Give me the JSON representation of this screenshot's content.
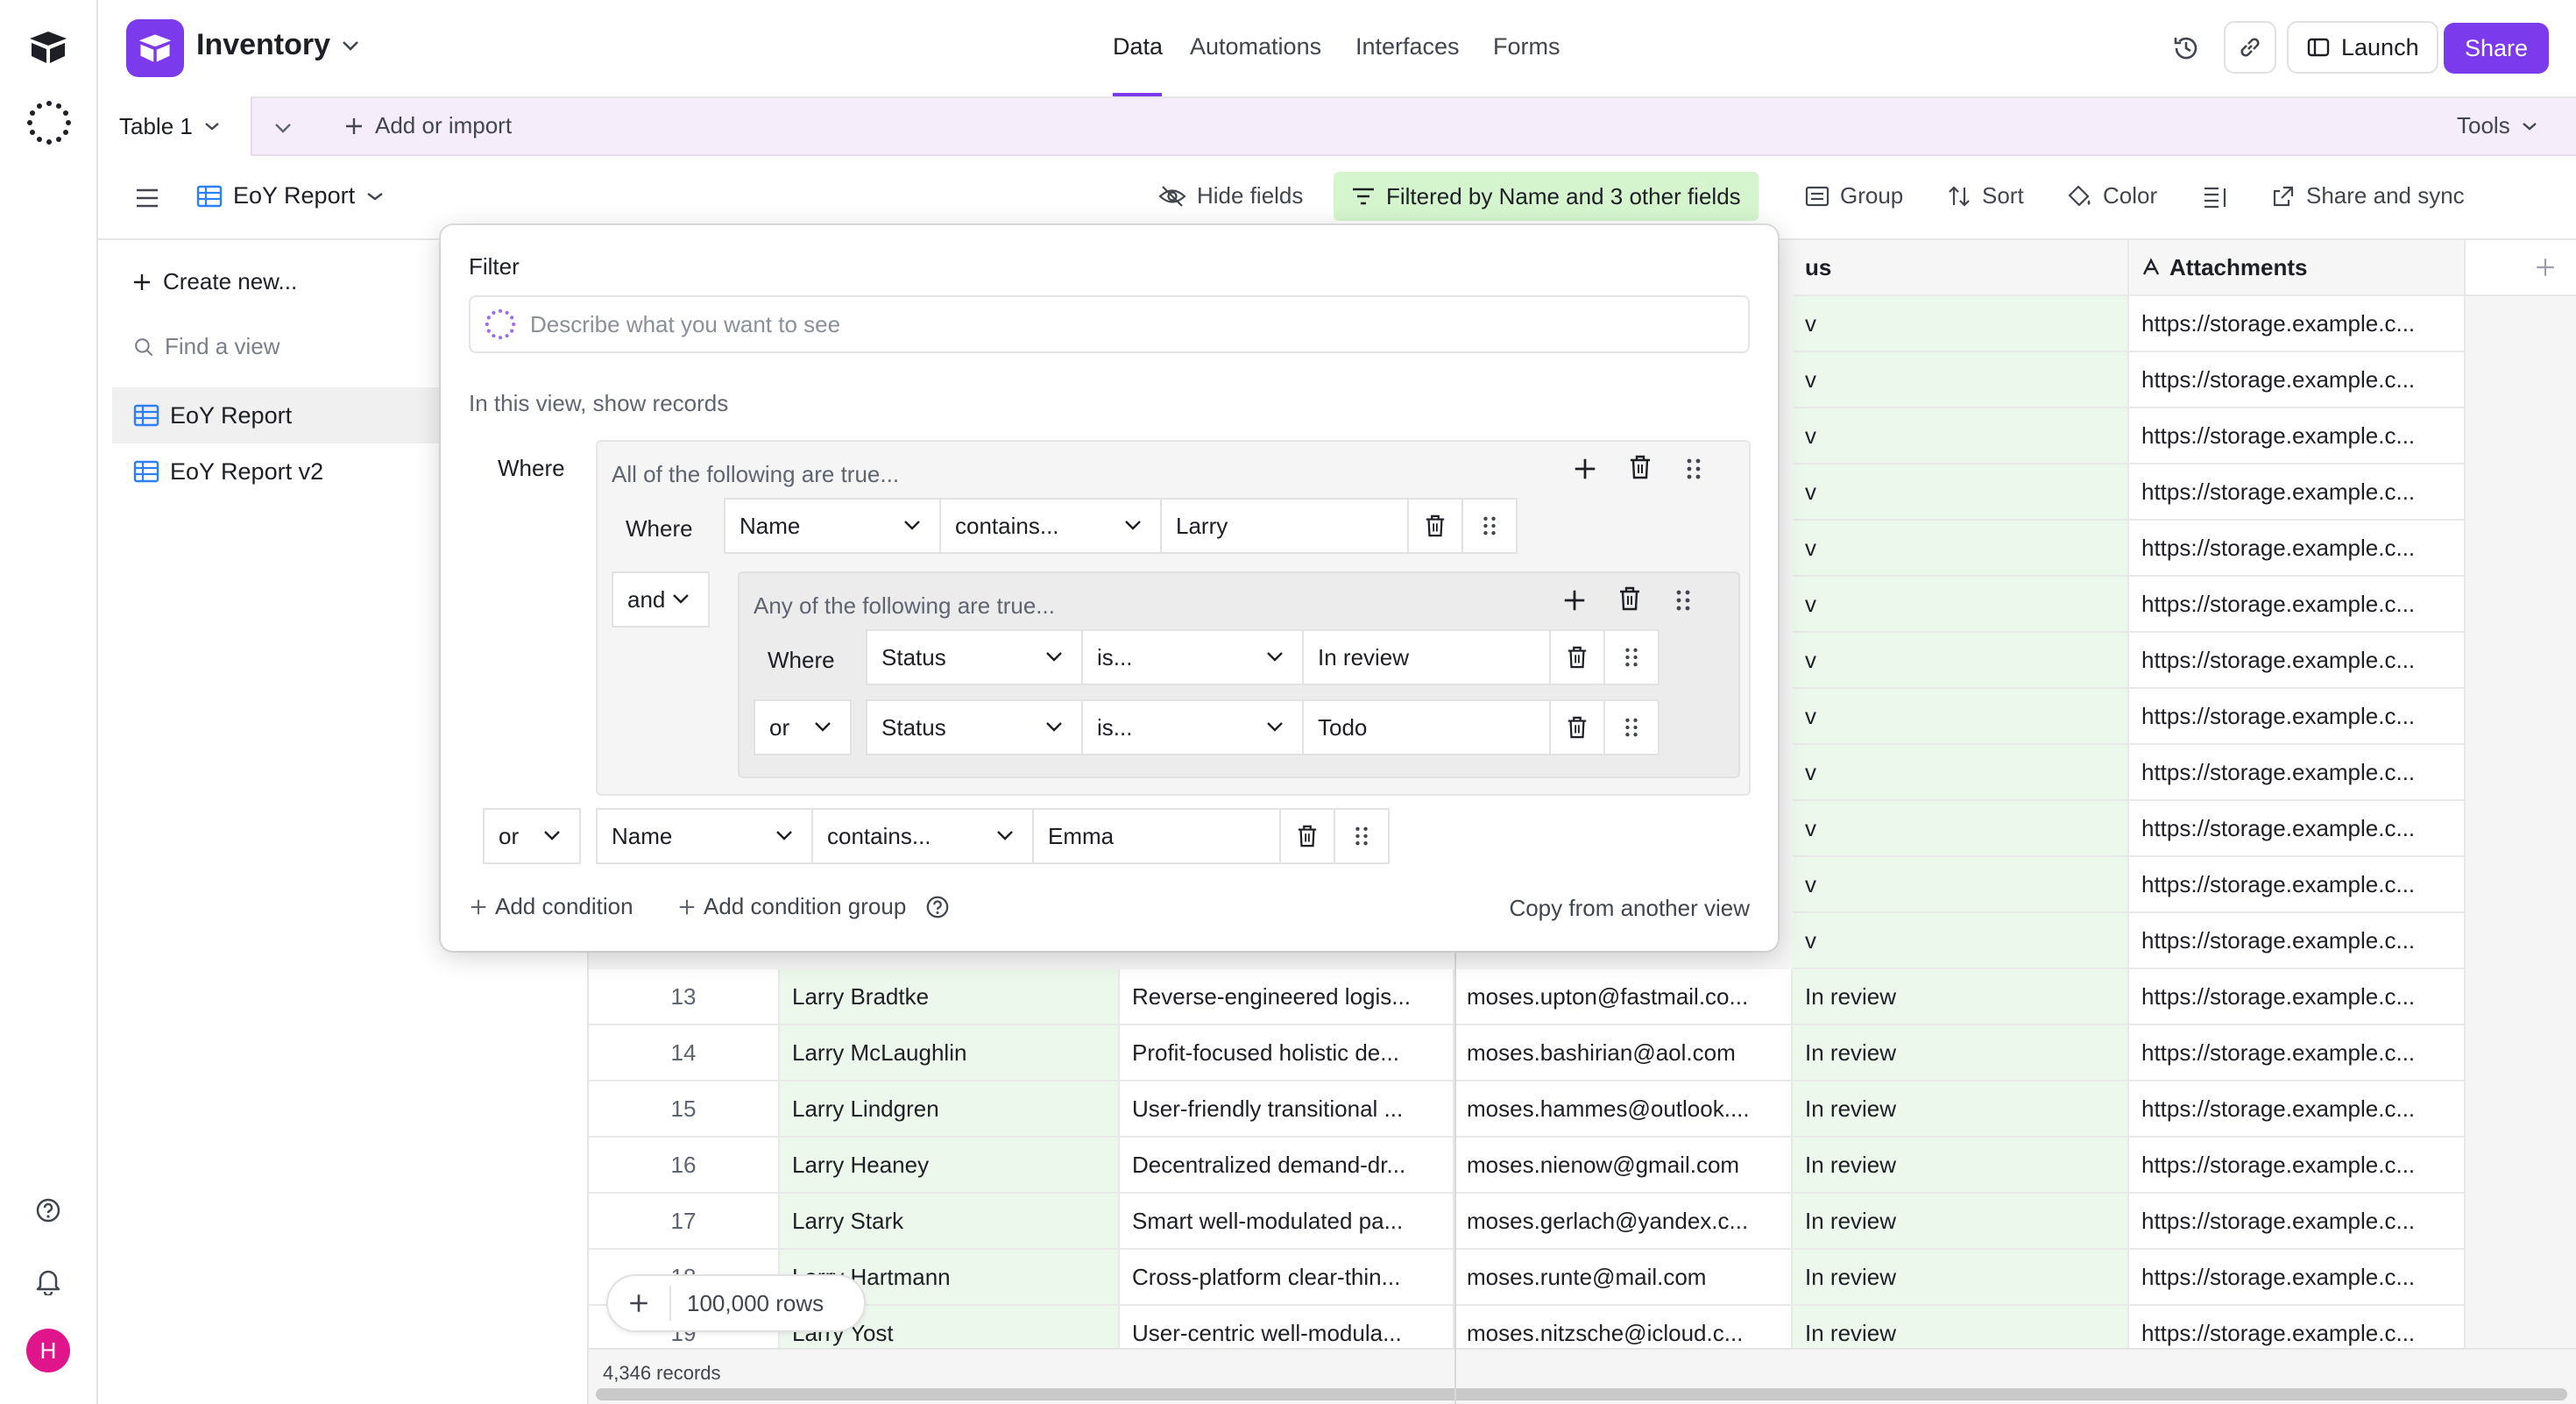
{
  "app": {
    "name": "Inventory",
    "brand_color": "#7c3aed"
  },
  "header": {
    "nav": [
      {
        "label": "Data",
        "active": true
      },
      {
        "label": "Automations",
        "active": false
      },
      {
        "label": "Interfaces",
        "active": false
      },
      {
        "label": "Forms",
        "active": false
      }
    ],
    "launch_label": "Launch",
    "share_label": "Share"
  },
  "tabs": {
    "table_label": "Table 1",
    "add_label": "Add or import",
    "tools_label": "Tools"
  },
  "viewbar": {
    "view_name": "EoY Report",
    "hide_fields": "Hide fields",
    "filtered": "Filtered by Name and 3 other fields",
    "group": "Group",
    "sort": "Sort",
    "color": "Color",
    "share_sync": "Share and sync"
  },
  "sidebar": {
    "create_new": "Create new...",
    "find_view": "Find a view",
    "views": [
      {
        "label": "EoY Report",
        "active": true
      },
      {
        "label": "EoY Report v2",
        "active": false
      }
    ]
  },
  "grid": {
    "status_header_partial": "us",
    "attachments_header": "Attachments",
    "attachment_value": "https://storage.example.c...",
    "partial_status": "v",
    "rows": [
      {
        "num": "13",
        "name": "Larry Bradtke",
        "notes": "Reverse-engineered logis...",
        "email": "moses.upton@fastmail.co...",
        "status": "In review"
      },
      {
        "num": "14",
        "name": "Larry McLaughlin",
        "notes": "Profit-focused holistic de...",
        "email": "moses.bashirian@aol.com",
        "status": "In review"
      },
      {
        "num": "15",
        "name": "Larry Lindgren",
        "notes": "User-friendly transitional ...",
        "email": "moses.hammes@outlook....",
        "status": "In review"
      },
      {
        "num": "16",
        "name": "Larry Heaney",
        "notes": "Decentralized demand-dr...",
        "email": "moses.nienow@gmail.com",
        "status": "In review"
      },
      {
        "num": "17",
        "name": "Larry Stark",
        "notes": "Smart well-modulated pa...",
        "email": "moses.gerlach@yandex.c...",
        "status": "In review"
      },
      {
        "num": "18",
        "name": "Larry Hartmann",
        "notes": "Cross-platform clear-thin...",
        "email": "moses.runte@mail.com",
        "status": "In review"
      },
      {
        "num": "19",
        "name": "Larry Yost",
        "notes": "User-centric well-modula...",
        "email": "moses.nitzsche@icloud.c...",
        "status": "In review"
      }
    ],
    "add_rows_label": "100,000 rows",
    "records_label": "4,346 records"
  },
  "filter": {
    "title": "Filter",
    "ai_placeholder": "Describe what you want to see",
    "show_records": "In this view, show records",
    "where": "Where",
    "group_all": "All of the following are true...",
    "cond1": {
      "where": "Where",
      "field": "Name",
      "op": "contains...",
      "value": "Larry"
    },
    "and_label": "and",
    "group_any": "Any of the following are true...",
    "cond2": {
      "where": "Where",
      "field": "Status",
      "op": "is...",
      "value": "In review"
    },
    "cond3": {
      "conj": "or",
      "field": "Status",
      "op": "is...",
      "value": "Todo"
    },
    "cond4": {
      "conj": "or",
      "field": "Name",
      "op": "contains...",
      "value": "Emma"
    },
    "add_condition": "Add condition",
    "add_condition_group": "Add condition group",
    "copy_from": "Copy from another view"
  },
  "user": {
    "avatar_initial": "H",
    "avatar_color": "#e0158c"
  }
}
